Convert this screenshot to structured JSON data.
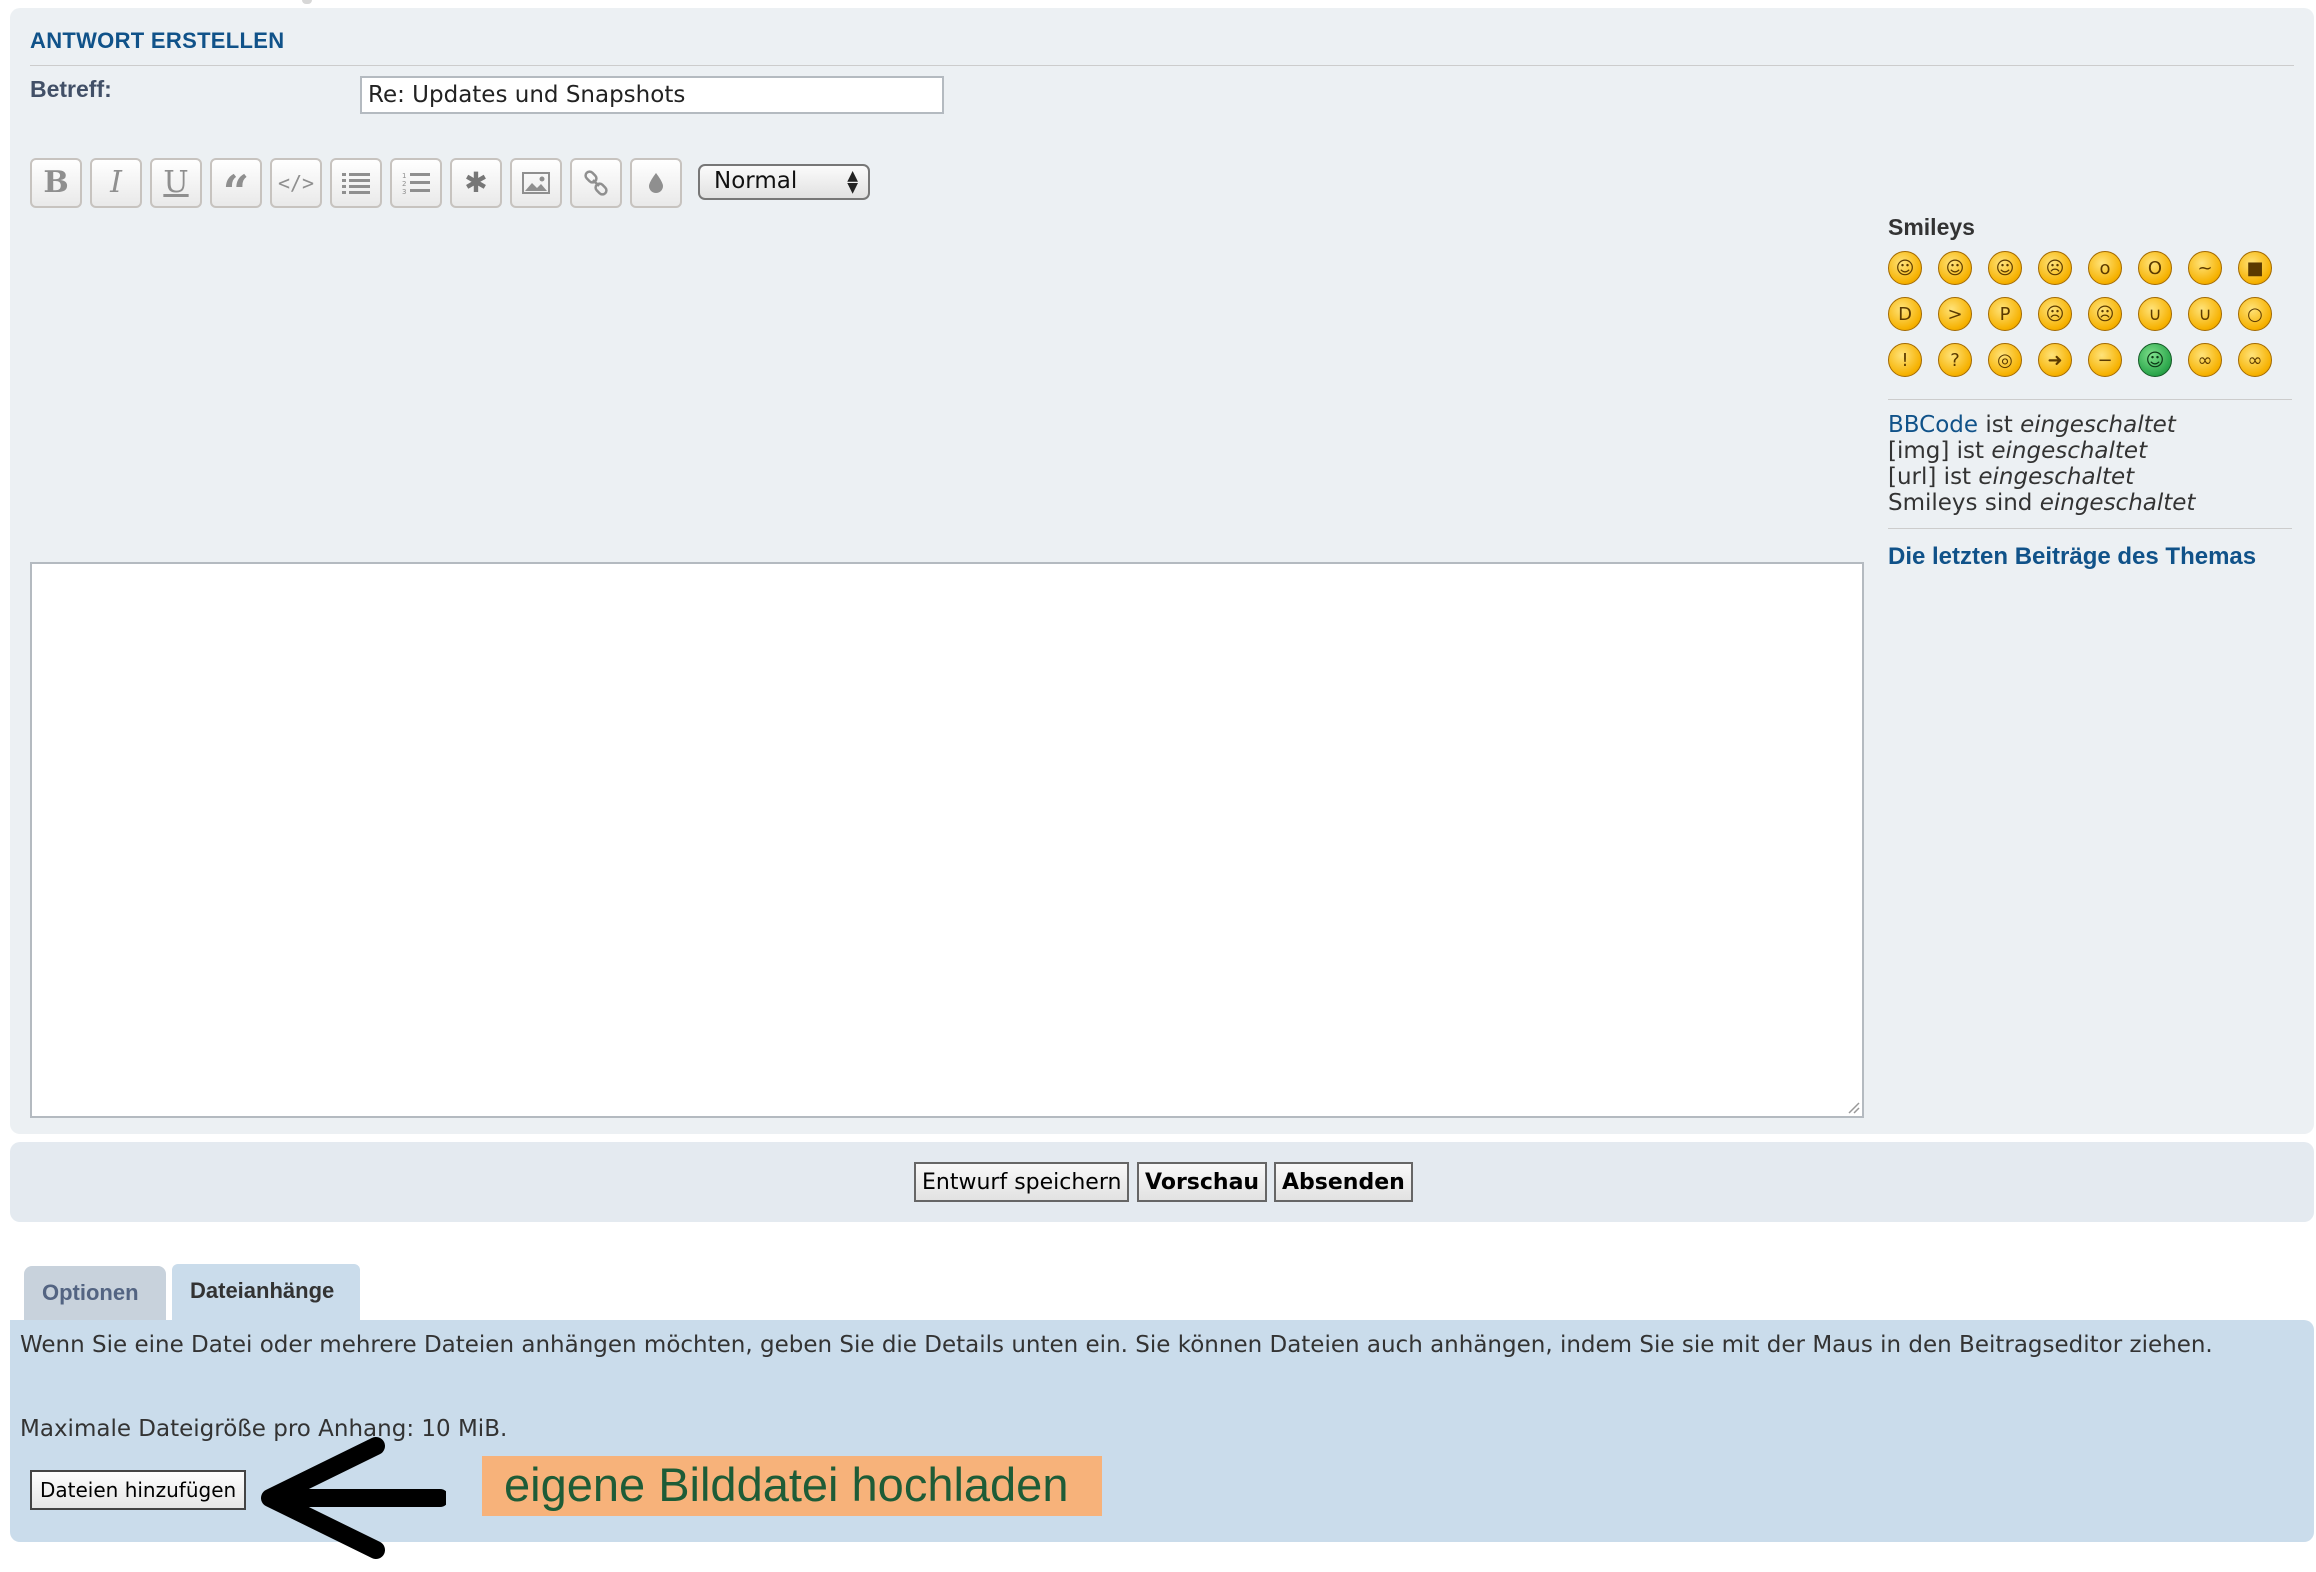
{
  "reply": {
    "title": "ANTWORT ERSTELLEN",
    "subject_label": "Betreff:",
    "subject_value": "Re: Updates und Snapshots"
  },
  "toolbar": {
    "buttons": [
      {
        "name": "bold-button",
        "icon": "bold-icon",
        "glyph": "B"
      },
      {
        "name": "italic-button",
        "icon": "italic-icon",
        "glyph": "I"
      },
      {
        "name": "underline-button",
        "icon": "underline-icon",
        "glyph": "U"
      },
      {
        "name": "quote-button",
        "icon": "quote-icon",
        "glyph": "“"
      },
      {
        "name": "code-button",
        "icon": "code-icon",
        "glyph": "</>"
      },
      {
        "name": "list-button",
        "icon": "list-icon",
        "glyph": ""
      },
      {
        "name": "numbered-list-button",
        "icon": "numbered-list-icon",
        "glyph": ""
      },
      {
        "name": "list-item-button",
        "icon": "asterisk-icon",
        "glyph": "✱"
      },
      {
        "name": "image-button",
        "icon": "image-icon",
        "glyph": ""
      },
      {
        "name": "link-button",
        "icon": "link-icon",
        "glyph": ""
      },
      {
        "name": "color-button",
        "icon": "drop-icon",
        "glyph": ""
      }
    ],
    "font_size": "Normal"
  },
  "sidebar": {
    "smileys_title": "Smileys",
    "smileys": [
      "very-happy-icon",
      "smile-icon",
      "wink-icon",
      "sad-icon",
      "surprised-icon",
      "eek-icon",
      "confused-icon",
      "cool-icon",
      "laughing-icon",
      "mad-icon",
      "razz-icon",
      "embarrassed-icon",
      "crying-icon",
      "evil-icon",
      "twisted-evil-icon",
      "rolling-eyes-icon",
      "exclamation-icon",
      "question-icon",
      "idea-icon",
      "arrow-icon",
      "neutral-icon",
      "green-mrgreen-icon",
      "geek-icon",
      "uber-geek-icon"
    ],
    "bbcode_link": "BBCode",
    "bbcode_rest": " ist ",
    "bbcode_state": "eingeschaltet",
    "img_label": "[img] ist ",
    "img_state": "eingeschaltet",
    "url_label": "[url] ist ",
    "url_state": "eingeschaltet",
    "smileys_label": "Smileys sind ",
    "smileys_state": "eingeschaltet",
    "last_posts": "Die letzten Beiträge des Themas"
  },
  "actions": {
    "save_draft": "Entwurf speichern",
    "preview": "Vorschau",
    "submit": "Absenden"
  },
  "tabs": {
    "options": "Optionen",
    "attachments": "Dateianhänge"
  },
  "attachments": {
    "info": "Wenn Sie eine Datei oder mehrere Dateien anhängen möchten, geben Sie die Details unten ein. Sie können Dateien auch anhängen, indem Sie sie mit der Maus in den Beitragseditor ziehen.",
    "max_size": "Maximale Dateigröße pro Anhang: 10 MiB.",
    "add_files": "Dateien hinzufügen",
    "annotation": "eigene Bilddatei hochladen"
  },
  "colors": {
    "accent": "#105289",
    "panel": "#ecf0f3",
    "attach_panel": "#cadceb",
    "annotation_bg": "#f7b27a",
    "annotation_text": "#1e5c37"
  }
}
